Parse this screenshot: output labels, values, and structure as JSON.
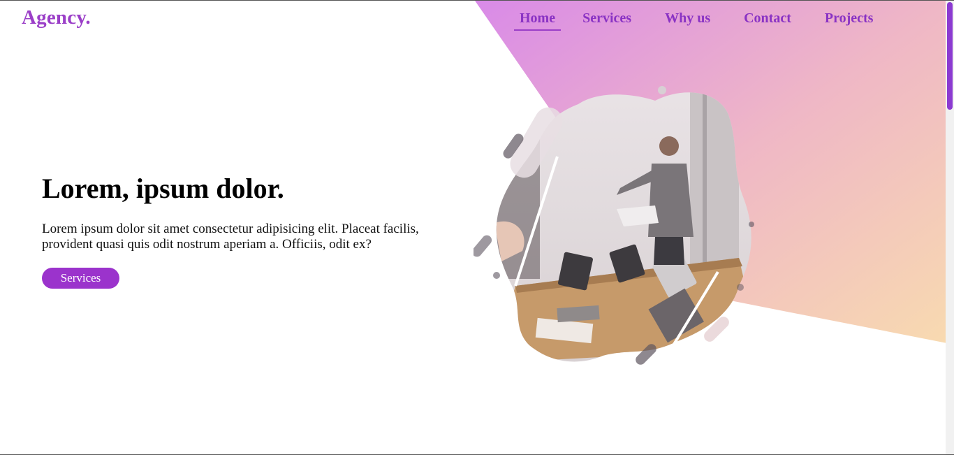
{
  "brand": {
    "logo": "Agency."
  },
  "nav": {
    "items": [
      {
        "label": "Home",
        "active": true
      },
      {
        "label": "Services",
        "active": false
      },
      {
        "label": "Why us",
        "active": false
      },
      {
        "label": "Contact",
        "active": false
      },
      {
        "label": "Projects",
        "active": false
      }
    ]
  },
  "hero": {
    "title": "Lorem, ipsum dolor.",
    "text": "Lorem ipsum dolor sit amet consectetur adipisicing elit. Placeat facilis, provident quasi quis odit nostrum aperiam a. Officiis, odit ex?",
    "button_label": "Services"
  },
  "colors": {
    "accent": "#9b33cc",
    "gradient_start": "#d88de6",
    "gradient_end": "#f6d6b0"
  }
}
